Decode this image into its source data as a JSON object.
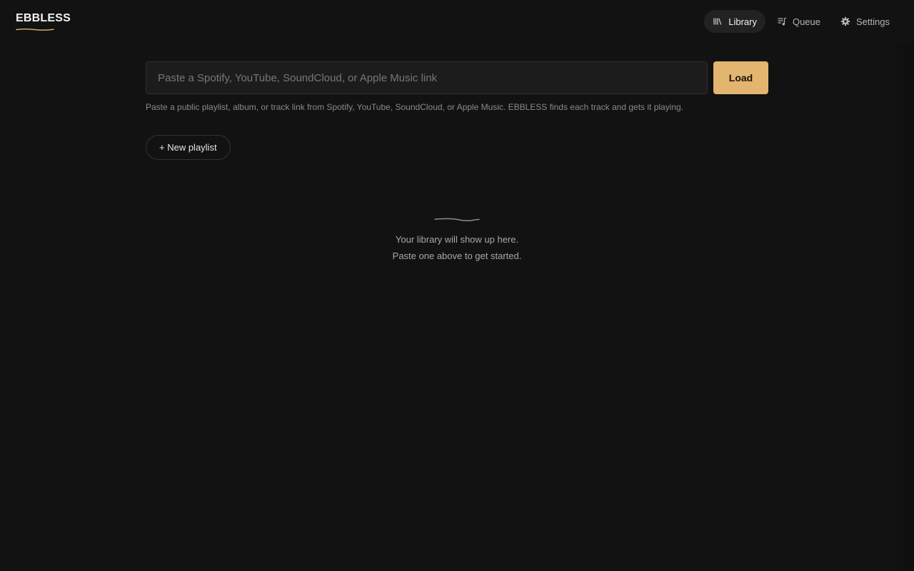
{
  "app": {
    "brand": "EBBLESS",
    "accent_color": "#e3b56f",
    "background_color": "#121212"
  },
  "nav": {
    "items": [
      {
        "label": "Library",
        "icon": "library-icon",
        "active": true
      },
      {
        "label": "Queue",
        "icon": "queue-icon",
        "active": false
      },
      {
        "label": "Settings",
        "icon": "gear-icon",
        "active": false
      }
    ]
  },
  "search": {
    "placeholder": "Paste a Spotify, YouTube, SoundCloud, or Apple Music link",
    "value": "",
    "load_label": "Load",
    "hint": "Paste a public playlist, album, or track link from Spotify, YouTube, SoundCloud, or Apple Music. EBBLESS finds each track and gets it playing."
  },
  "actions": {
    "new_playlist_label": "+ New playlist"
  },
  "empty_state": {
    "line1": "Your library will show up here.",
    "line2": "Paste one above to get started."
  }
}
